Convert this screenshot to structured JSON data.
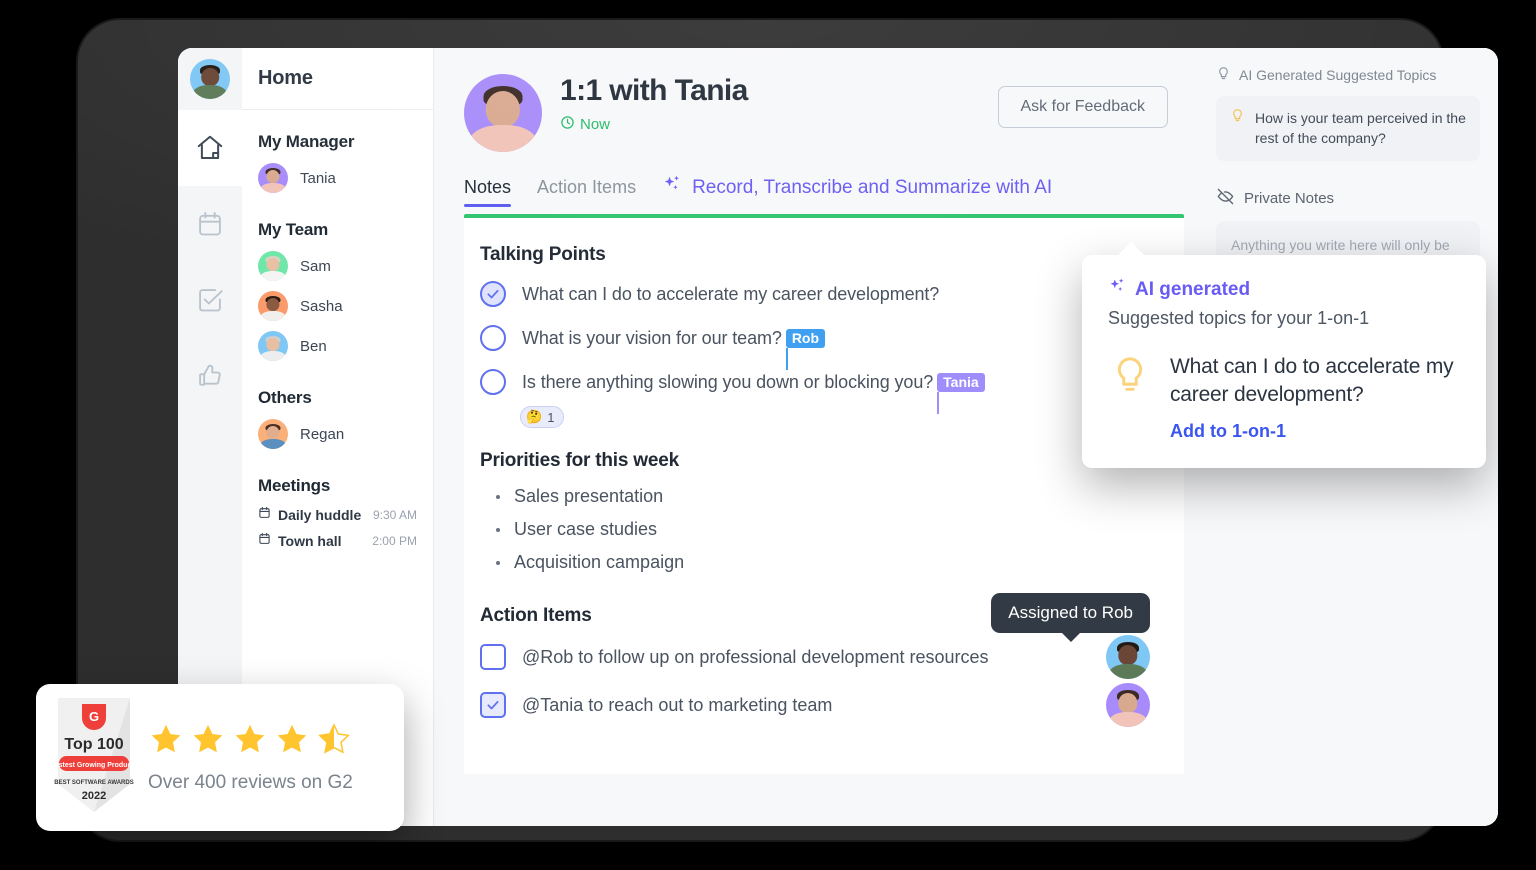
{
  "rail": {
    "items": [
      {
        "name": "home-icon",
        "active": true
      },
      {
        "name": "calendar-icon",
        "active": false
      },
      {
        "name": "tasks-icon",
        "active": false
      },
      {
        "name": "thumbs-up-icon",
        "active": false
      }
    ]
  },
  "sidebar": {
    "home_label": "Home",
    "sections": [
      {
        "title": "My Manager",
        "people": [
          {
            "name": "Tania",
            "color": "#a78bfa"
          }
        ]
      },
      {
        "title": "My Team",
        "people": [
          {
            "name": "Sam",
            "color": "#6ee7a8"
          },
          {
            "name": "Sasha",
            "color": "#fb9a6a"
          },
          {
            "name": "Ben",
            "color": "#7fc7f5"
          }
        ]
      },
      {
        "title": "Others",
        "people": [
          {
            "name": "Regan",
            "color": "#fbb07a"
          }
        ]
      }
    ],
    "meetings_title": "Meetings",
    "meetings": [
      {
        "label": "Daily huddle",
        "time": "9:30 AM"
      },
      {
        "label": "Town hall",
        "time": "2:00 PM"
      }
    ]
  },
  "header": {
    "title": "1:1 with Tania",
    "status": "Now",
    "status_color": "#22bb66",
    "feedback_button": "Ask for Feedback"
  },
  "tabs": {
    "items": [
      {
        "label": "Notes",
        "active": true
      },
      {
        "label": "Action Items",
        "active": false
      }
    ],
    "ai_link": "Record, Transcribe and Summarize with AI",
    "ai_link_color": "#6a5bf3",
    "accent_bar_color": "#2fc56e"
  },
  "notes": {
    "talking_points_title": "Talking Points",
    "talking_points": [
      {
        "text": "What can I do to accelerate my career development?",
        "checked": true,
        "cursor": null,
        "avatar": "#7fc7f5",
        "reaction": null
      },
      {
        "text": "What is your vision for our team?",
        "checked": false,
        "cursor": {
          "name": "Rob",
          "color": "#3fa0f2"
        },
        "avatar": "#7fc7f5",
        "reaction": null
      },
      {
        "text": "Is there anything slowing you down or blocking you?",
        "checked": false,
        "cursor": {
          "name": "Tania",
          "color": "#9f8dfb"
        },
        "avatar": "#a78bfa",
        "reaction": {
          "emoji": "🤔",
          "count": "1"
        }
      }
    ],
    "priorities_title": "Priorities for this week",
    "priorities": [
      "Sales presentation",
      "User case studies",
      "Acquisition campaign"
    ],
    "action_items_title": "Action Items",
    "action_items": [
      {
        "text": "@Rob to follow up on professional development resources",
        "checked": false,
        "avatar": "#7fc7f5"
      },
      {
        "text": "@Tania to reach out to marketing team",
        "checked": true,
        "avatar": "#a78bfa"
      }
    ],
    "tooltip": "Assigned to Rob"
  },
  "right_panel": {
    "suggested_header": "AI Generated Suggested Topics",
    "suggestions": [
      "How is your team perceived in the rest of the company?"
    ],
    "private_notes_header": "Private Notes",
    "private_notes_placeholder": "Anything you write here will only be visible to you."
  },
  "popover": {
    "badge": "AI generated",
    "subtitle": "Suggested topics for your 1-on-1",
    "question": "What can I do to accelerate my career development?",
    "cta": "Add to 1-on-1",
    "accent": "#6a5bf3"
  },
  "g2_card": {
    "badge_top": "Top 100",
    "badge_ribbon": "Fastest Growing Products",
    "badge_sub": "BEST SOFTWARE AWARDS",
    "badge_year": "2022",
    "stars_full": 4,
    "stars_half": 1,
    "star_color": "#ffc42e",
    "caption": "Over 400 reviews on G2"
  }
}
